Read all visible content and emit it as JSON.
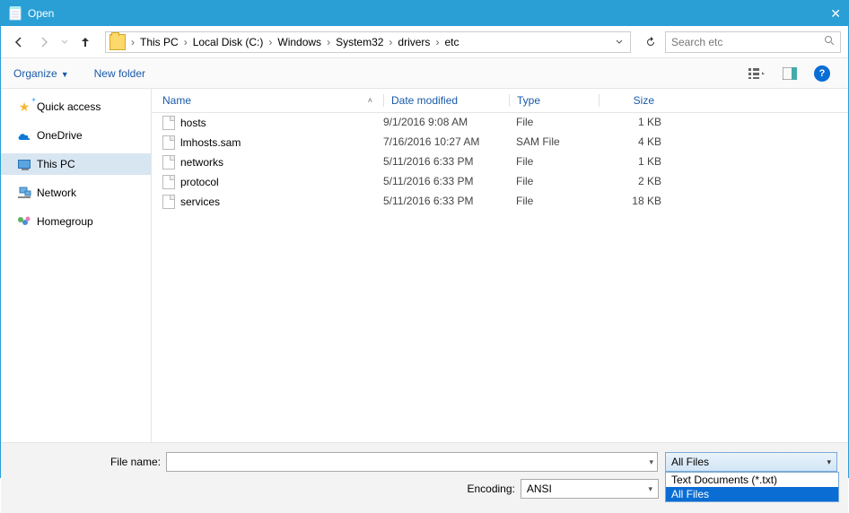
{
  "window": {
    "title": "Open"
  },
  "breadcrumb": {
    "items": [
      "This PC",
      "Local Disk (C:)",
      "Windows",
      "System32",
      "drivers",
      "etc"
    ]
  },
  "search": {
    "placeholder": "Search etc"
  },
  "toolbar": {
    "organize": "Organize",
    "new_folder": "New folder"
  },
  "sidebar": {
    "items": [
      {
        "label": "Quick access"
      },
      {
        "label": "OneDrive"
      },
      {
        "label": "This PC"
      },
      {
        "label": "Network"
      },
      {
        "label": "Homegroup"
      }
    ]
  },
  "columns": {
    "name": "Name",
    "date": "Date modified",
    "type": "Type",
    "size": "Size"
  },
  "files": [
    {
      "name": "hosts",
      "date": "9/1/2016 9:08 AM",
      "type": "File",
      "size": "1 KB"
    },
    {
      "name": "lmhosts.sam",
      "date": "7/16/2016 10:27 AM",
      "type": "SAM File",
      "size": "4 KB"
    },
    {
      "name": "networks",
      "date": "5/11/2016 6:33 PM",
      "type": "File",
      "size": "1 KB"
    },
    {
      "name": "protocol",
      "date": "5/11/2016 6:33 PM",
      "type": "File",
      "size": "2 KB"
    },
    {
      "name": "services",
      "date": "5/11/2016 6:33 PM",
      "type": "File",
      "size": "18 KB"
    }
  ],
  "footer": {
    "filename_label": "File name:",
    "encoding_label": "Encoding:",
    "encoding_value": "ANSI",
    "type_selected": "All Files",
    "type_options": [
      "Text Documents (*.txt)",
      "All Files"
    ]
  }
}
